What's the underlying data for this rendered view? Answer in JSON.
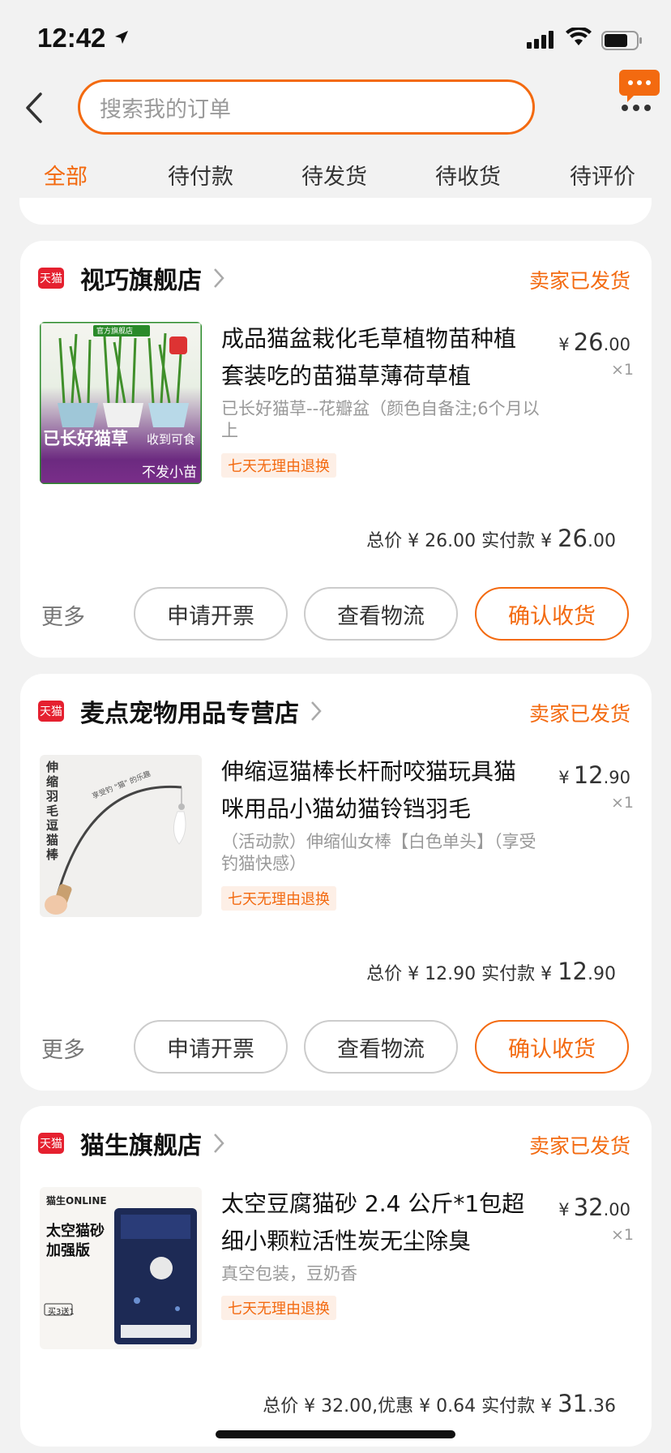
{
  "status_bar": {
    "time": "12:42"
  },
  "search": {
    "placeholder": "搜索我的订单"
  },
  "tabs": [
    {
      "label": "全部",
      "active": true
    },
    {
      "label": "待付款"
    },
    {
      "label": "待发货"
    },
    {
      "label": "待收货"
    },
    {
      "label": "待评价"
    }
  ],
  "orders": [
    {
      "shop": "视巧旗舰店",
      "shop_badge": "天猫",
      "status": "卖家已发货",
      "title": "成品猫盆栽化毛草植物苗种植套装吃的苗猫草薄荷草植",
      "spec": "已长好猫草--花瓣盆（颜色自备注;6个月以上",
      "tag": "七天无理由退换",
      "price_currency": "¥",
      "price_int": "26",
      "price_dec": ".00",
      "qty": "×1",
      "total_prefix": "总价 ¥ 26.00  实付款 ¥ ",
      "total_int": "26",
      "total_dec": ".00",
      "more": "更多",
      "btn1": "申请开票",
      "btn2": "查看物流",
      "btn3": "确认收货",
      "thumb_texts": [
        "官方旗舰店",
        "已长好猫草",
        "收到可食",
        "不发小苗"
      ]
    },
    {
      "shop": "麦点宠物用品专营店",
      "shop_badge": "天猫",
      "status": "卖家已发货",
      "title": "伸缩逗猫棒长杆耐咬猫玩具猫咪用品小猫幼猫铃铛羽毛",
      "spec": "（活动款）伸缩仙女棒【白色单头】（享受钓猫快感）",
      "tag": "七天无理由退换",
      "price_currency": "¥",
      "price_int": "12",
      "price_dec": ".90",
      "qty": "×1",
      "total_prefix": "总价 ¥ 12.90  实付款 ¥ ",
      "total_int": "12",
      "total_dec": ".90",
      "more": "更多",
      "btn1": "申请开票",
      "btn2": "查看物流",
      "btn3": "确认收货",
      "thumb_texts": [
        "伸缩羽毛逗猫棒",
        "享受钓 \"猫\" 的乐趣"
      ]
    },
    {
      "shop": "猫生旗舰店",
      "shop_badge": "天猫",
      "status": "卖家已发货",
      "title": "太空豆腐猫砂 2.4 公斤*1包超细小颗粒活性炭无尘除臭",
      "spec": "真空包装，豆奶香",
      "tag": "七天无理由退换",
      "price_currency": "¥",
      "price_int": "32",
      "price_dec": ".00",
      "qty": "×1",
      "total_prefix": "总价 ¥ 32.00,优惠 ¥ 0.64  实付款 ¥ ",
      "total_int": "31",
      "total_dec": ".36",
      "thumb_texts": [
        "猫生ONLINE",
        "太空猫砂",
        "加强版",
        "买3送1"
      ]
    }
  ],
  "colors": {
    "accent": "#f36a10",
    "tmall_red": "#e5202f",
    "background": "#f2f2f2"
  }
}
